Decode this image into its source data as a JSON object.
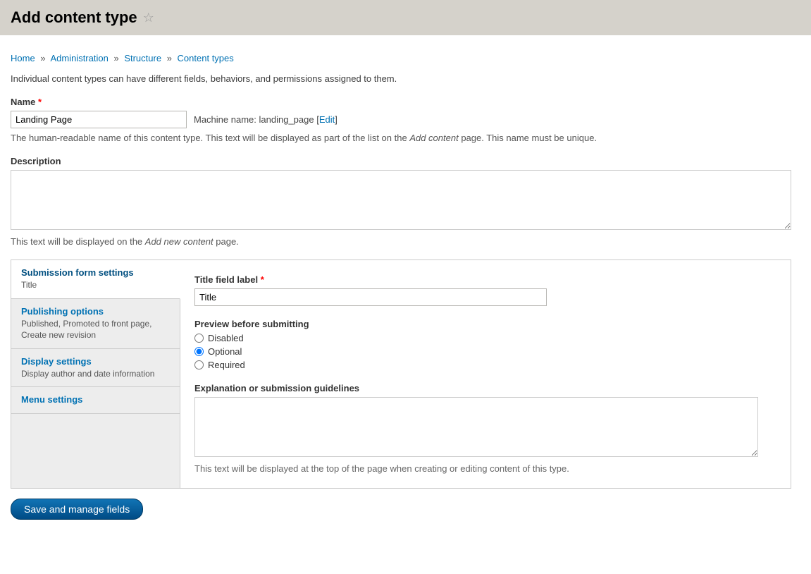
{
  "header": {
    "title": "Add content type"
  },
  "breadcrumb": {
    "items": [
      "Home",
      "Administration",
      "Structure",
      "Content types"
    ]
  },
  "intro": "Individual content types can have different fields, behaviors, and permissions assigned to them.",
  "name": {
    "label": "Name",
    "value": "Landing Page",
    "machine_label": "Machine name:",
    "machine_value": "landing_page",
    "edit_label": "Edit",
    "help_pre": "The human-readable name of this content type. This text will be displayed as part of the list on the ",
    "help_em": "Add content",
    "help_post": " page. This name must be unique."
  },
  "description": {
    "label": "Description",
    "value": "",
    "help_pre": "This text will be displayed on the ",
    "help_em": "Add new content",
    "help_post": " page."
  },
  "tabs": [
    {
      "title": "Submission form settings",
      "summary": "Title"
    },
    {
      "title": "Publishing options",
      "summary": "Published, Promoted to front page, Create new revision"
    },
    {
      "title": "Display settings",
      "summary": "Display author and date information"
    },
    {
      "title": "Menu settings",
      "summary": ""
    }
  ],
  "tab_content": {
    "title_field": {
      "label": "Title field label",
      "value": "Title"
    },
    "preview": {
      "group_label": "Preview before submitting",
      "options": [
        "Disabled",
        "Optional",
        "Required"
      ],
      "selected": "Optional"
    },
    "guidelines": {
      "label": "Explanation or submission guidelines",
      "value": "",
      "help": "This text will be displayed at the top of the page when creating or editing content of this type."
    }
  },
  "submit": {
    "label": "Save and manage fields"
  }
}
